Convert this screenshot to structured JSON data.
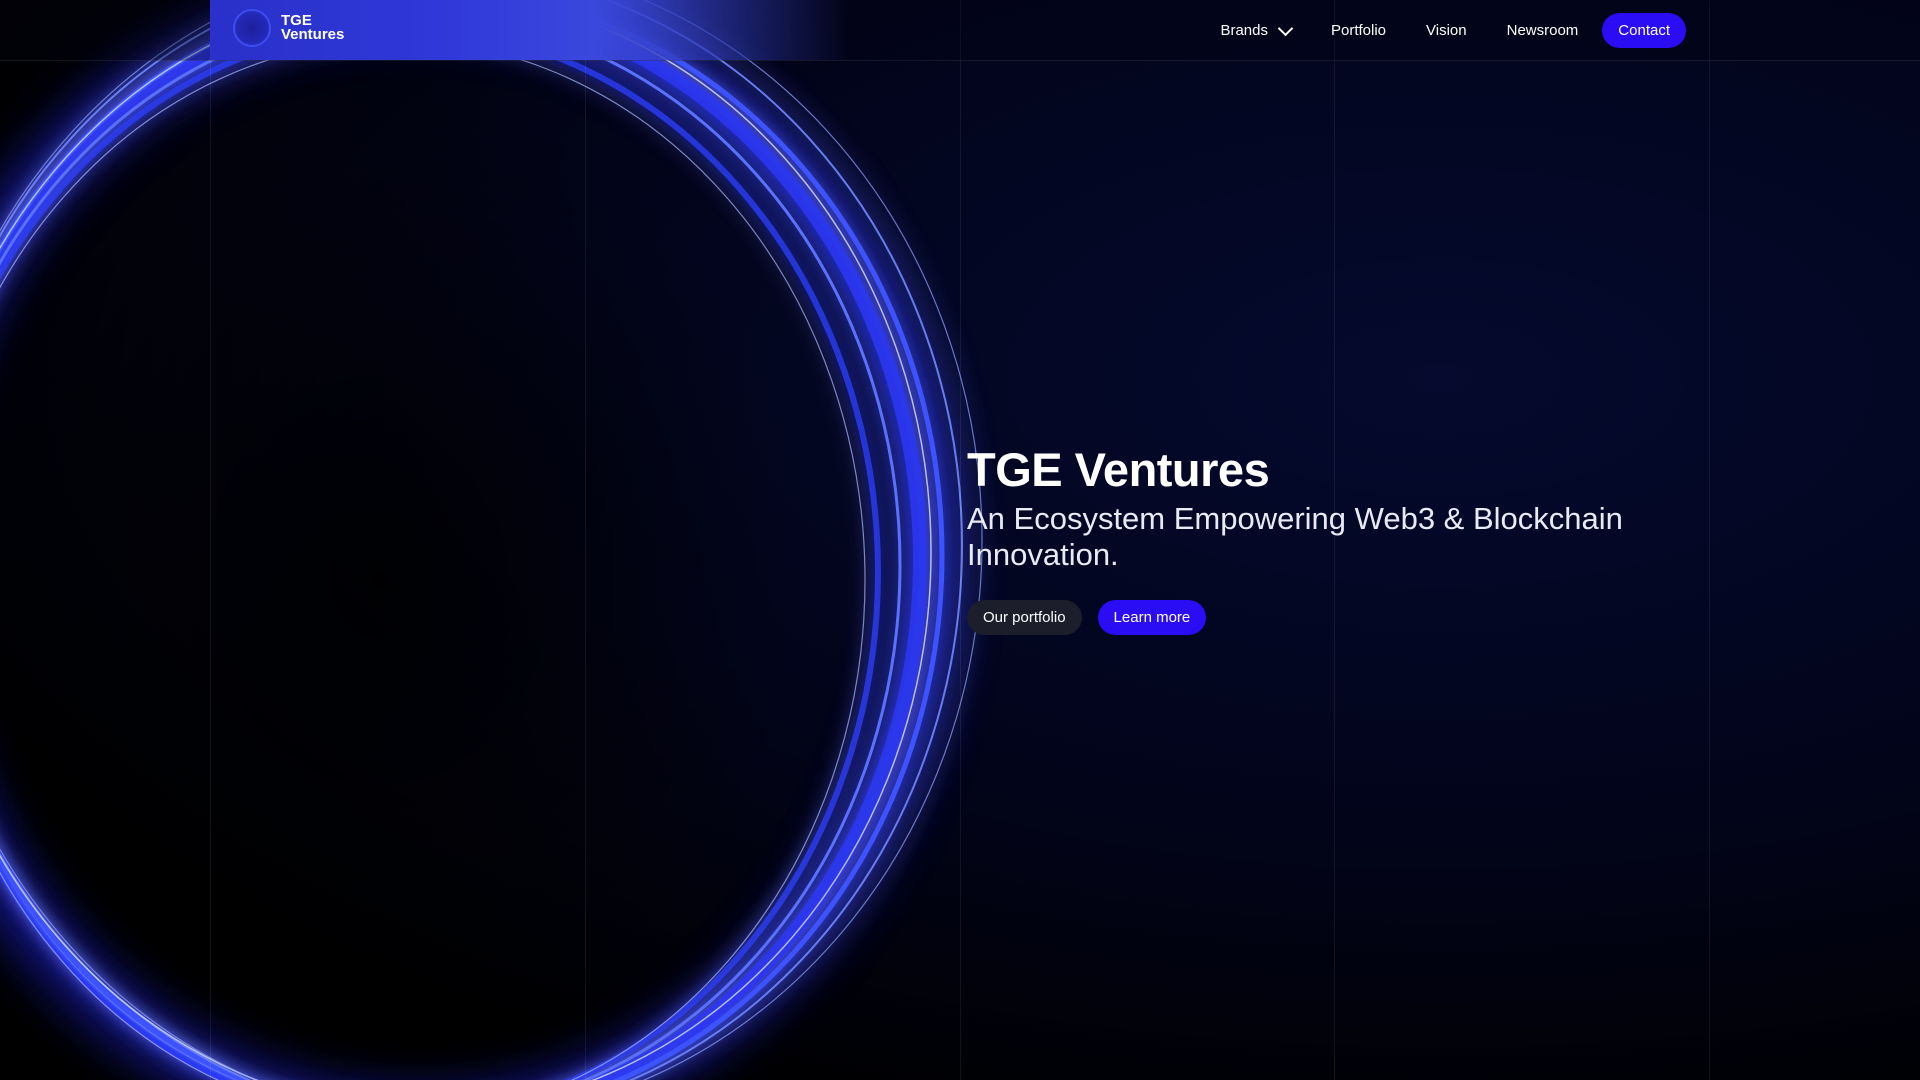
{
  "colors": {
    "accent": "#2a0cf5",
    "background": "#000000",
    "glow": "#3a4cff"
  },
  "logo": {
    "icon": "circle-logo-icon",
    "line1": "TGE",
    "line2": "Ventures"
  },
  "nav": {
    "items": [
      {
        "label": "Brands",
        "icon": "chevron-down-icon"
      },
      {
        "label": "Portfolio"
      },
      {
        "label": "Vision"
      },
      {
        "label": "Newsroom"
      }
    ],
    "contact_label": "Contact"
  },
  "hero": {
    "title": "TGE Ventures",
    "subtitle_line1": "An Ecosystem Empowering Web3 & Blockchain",
    "subtitle_line2": "Innovation.",
    "secondary_button": "Our portfolio",
    "primary_button": "Learn more"
  }
}
